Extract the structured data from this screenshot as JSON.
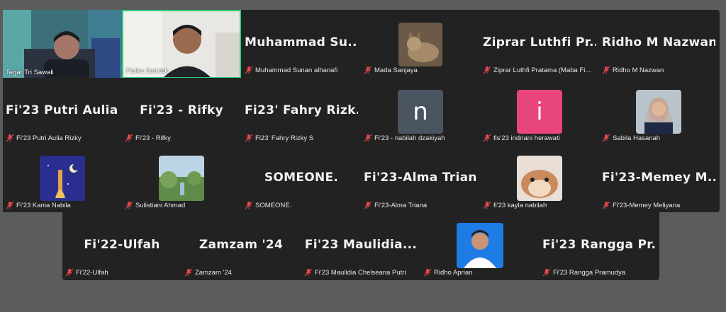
{
  "video_tiles": [
    {
      "label": "Tegar Tri Sawali"
    },
    {
      "label": "Fisika Saintek"
    }
  ],
  "row1": [
    {
      "big": "Muhammad  Su...",
      "label": "Muhammad Sunan alhanafi"
    },
    {
      "label": "Mada Sanjaya",
      "avatar": "cat-photo"
    },
    {
      "big": "Ziprar  Luthfi  Pr...",
      "label": "Ziprar Luthfi Pratama (Maba Fi..."
    },
    {
      "big": "Ridho M Nazwan",
      "label": "Ridho M Nazwan"
    }
  ],
  "row2": [
    {
      "big": "Fi'23  Putri  Aulia...",
      "label": "Fi'23 Putri Aulia Rizky"
    },
    {
      "big": "Fi'23  -  Rifky",
      "label": "Fi'23 - Rifky"
    },
    {
      "big": "Fi23'  Fahry  Rizk...",
      "label": "Fi23' Fahry Rizky S"
    },
    {
      "initial": "n",
      "initial_color": "#4a5561",
      "label": "Fi'23 - nabilah dzakiyah"
    },
    {
      "initial": "i",
      "initial_color": "#e8457a",
      "label": "fis'23 indriani herawati"
    },
    {
      "label": "Sabila Hasanah",
      "avatar": "hijab-photo"
    }
  ],
  "row3": [
    {
      "label": "Fi'23 Kania Nabila",
      "avatar": "night-mosque-art"
    },
    {
      "label": "Sulistiani Ahmad",
      "avatar": "nature-photo"
    },
    {
      "big": "SOMEONE.",
      "label": "SOMEONE."
    },
    {
      "big": "Fi'23-Alma Triana",
      "label": "Fi'23-Alma Triana"
    },
    {
      "label": "fi'23 kayla nabilah",
      "avatar": "hamster-photo"
    },
    {
      "big": "Fi'23-Memey  M...",
      "label": "Fi'23-Memey Meliyana"
    }
  ],
  "row4": [
    {
      "big": "Fi'22-Ulfah",
      "label": "Fi'22-Ulfah"
    },
    {
      "big": "Zamzam  '24",
      "label": "Zamzam '24"
    },
    {
      "big": "Fi'23  Maulidia...",
      "label": "Fi'23 Maulidia Chelseana Putri"
    },
    {
      "label": "Ridho Aprian",
      "avatar": "portrait-photo"
    },
    {
      "big": "Fi'23  Rangga  Pr...",
      "label": "Fi'23 Rangga Pramudya"
    }
  ],
  "colors": {
    "mute_icon": "#e5484d",
    "active_speaker_border": "#2fd07a",
    "tile_bg": "#222222"
  }
}
